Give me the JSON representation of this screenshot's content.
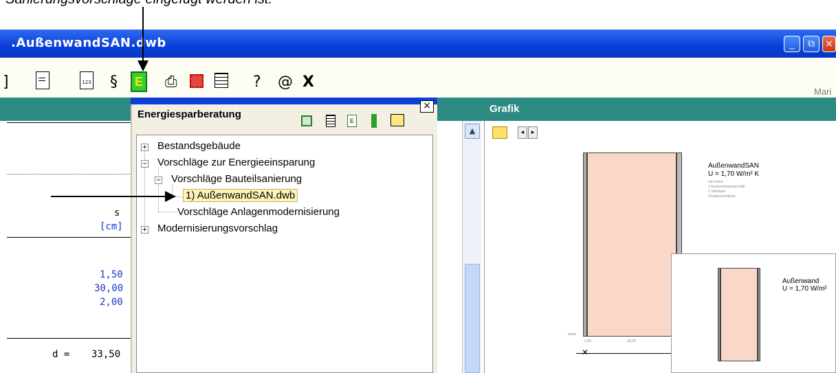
{
  "caption": "Sanierungsvorschläge eingefügt werden ist.",
  "window": {
    "title": ".AußenwandSAN.dwb",
    "buttons": {
      "minimize": "_",
      "restore": "⧉",
      "close": "×"
    }
  },
  "toolbar": {
    "right_label": "Mari",
    "e_label": "E",
    "help": "?",
    "at": "@",
    "close": "X"
  },
  "left_panel": {
    "col_s": "s",
    "col_unit": "[cm]",
    "values": [
      "1,50",
      "30,00",
      "2,00"
    ],
    "total_label": "d =",
    "total_value": "33,50"
  },
  "dialog": {
    "title": "Energiesparberatung",
    "close": "×",
    "tree": [
      {
        "label": "Bestandsgebäude",
        "expander": "+"
      },
      {
        "label": "Vorschläge zur Energieeinsparung",
        "expander": "−"
      },
      {
        "label": "Vorschläge Bauteilsanierung",
        "expander": "−"
      },
      {
        "label": "1) AußenwandSAN.dwb",
        "selected": true
      },
      {
        "label": "Vorschläge Anlagenmodernisierung"
      },
      {
        "label": "Modernisierungsvorschlag",
        "expander": "+"
      }
    ]
  },
  "grafik": {
    "title": "Grafik",
    "wall_name": "AußenwandSAN",
    "wall_u": "U = 1,70 W/m² K",
    "layers_header": "von innen",
    "layers": [
      "1 Aussenhinterputz Kalk",
      "2 Vollziegel",
      "3 Kalkzementputz"
    ],
    "innen": "innen",
    "dim1": "1,50",
    "dim2": "30,00",
    "popup_name": "Außenwand",
    "popup_u": "U = 1,70 W/m²"
  }
}
